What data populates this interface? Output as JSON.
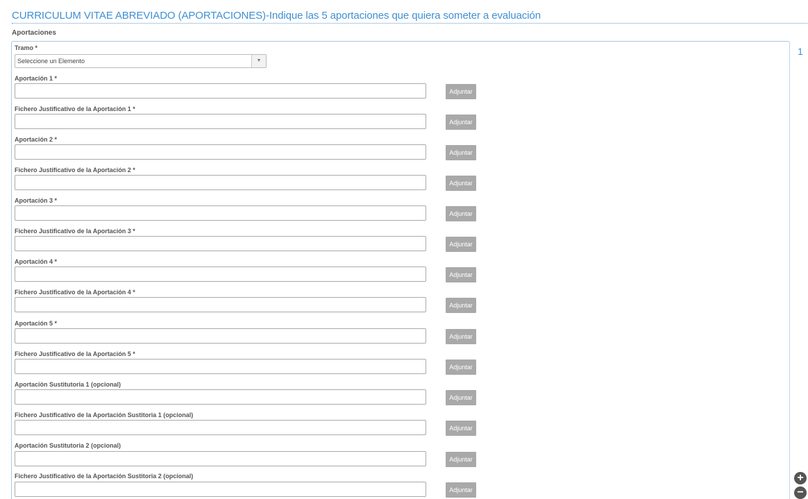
{
  "section": {
    "title": "CURRICULUM VITAE ABREVIADO (APORTACIONES)-Indique las 5 aportaciones que quiera someter a evaluación",
    "group_label": "Aportaciones",
    "counter": "1"
  },
  "tramo": {
    "label": "Tramo *",
    "selected": "Seleccione un Elemento",
    "arrow": "▼"
  },
  "fields": [
    {
      "label": "Aportación 1 *",
      "value": "",
      "button": "Adjuntar"
    },
    {
      "label": "Fichero Justificativo de la Aportación 1 *",
      "value": "",
      "button": "Adjuntar"
    },
    {
      "label": "Aportación 2 *",
      "value": "",
      "button": "Adjuntar"
    },
    {
      "label": "Fichero Justificativo de la Aportación 2 *",
      "value": "",
      "button": "Adjuntar"
    },
    {
      "label": "Aportación 3 *",
      "value": "",
      "button": "Adjuntar"
    },
    {
      "label": "Fichero Justificativo de la Aportación 3 *",
      "value": "",
      "button": "Adjuntar"
    },
    {
      "label": "Aportación 4 *",
      "value": "",
      "button": "Adjuntar"
    },
    {
      "label": "Fichero Justificativo de la Aportación 4 *",
      "value": "",
      "button": "Adjuntar"
    },
    {
      "label": "Aportación 5 *",
      "value": "",
      "button": "Adjuntar"
    },
    {
      "label": "Fichero Justificativo de la Aportación 5 *",
      "value": "",
      "button": "Adjuntar"
    },
    {
      "label": "Aportación Sustitutoria 1 (opcional)",
      "value": "",
      "button": "Adjuntar"
    },
    {
      "label": "Fichero Justificativo de la Aportación Sustitoria 1 (opcional)",
      "value": "",
      "button": "Adjuntar"
    },
    {
      "label": "Aportación Sustitutoria 2 (opcional)",
      "value": "",
      "button": "Adjuntar"
    },
    {
      "label": "Fichero Justificativo de la Aportación Sustitoria 2 (opcional)",
      "value": "",
      "button": "Adjuntar"
    }
  ],
  "controls": {
    "add": "+",
    "remove": "−"
  },
  "colors": {
    "accent": "#3f8fd2",
    "button_gray": "#a9a9a9",
    "round_button": "#555555"
  },
  "icons": {
    "add": "plus-circle-icon",
    "remove": "minus-circle-icon",
    "dropdown": "caret-down-icon"
  }
}
